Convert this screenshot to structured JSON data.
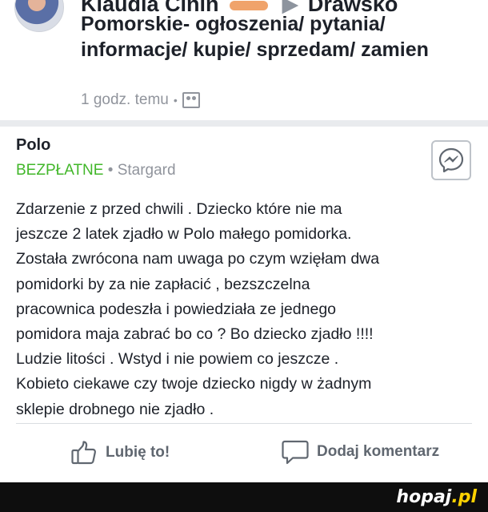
{
  "post_header": {
    "author_visible": "Klaudia  Cinin",
    "group_partial": "Drawsko",
    "group_name": "Pomorskie- ogłoszenia/ pytania/ informacje/ kupie/ sprzedam/ zamien",
    "time": "1 godz. temu",
    "separator": "•",
    "audience_icon": "group-icon"
  },
  "listing": {
    "title": "Polo",
    "price": "BEZPŁATNE",
    "separator": "•",
    "location": "Stargard",
    "messenger_icon": "messenger-icon"
  },
  "post": {
    "lines": [
      "Zdarzenie z przed chwili . Dziecko które nie ma",
      "jeszcze 2 latek zjadło w Polo małego pomidorka.",
      "Została zwrócona nam uwaga po czym wzięłam dwa",
      "pomidorki by za nie zapłacić , bezszczelna",
      "pracownica podeszła i powiedziała ze jednego",
      "pomidora maja zabrać bo co ? Bo dziecko zjadło !!!!",
      "Ludzie litości . Wstyd i nie powiem co jeszcze .",
      "Kobieto ciekawe czy twoje dziecko nigdy w żadnym",
      "sklepie drobnego nie zjadło ."
    ]
  },
  "actions": {
    "like_label": "Lubię to!",
    "comment_label": "Dodaj komentarz",
    "like_icon": "thumbs-up-icon",
    "comment_icon": "comment-bubble-icon"
  },
  "watermark": {
    "name": "hopaj",
    "tld": ".pl"
  },
  "colors": {
    "price_green": "#42b72a",
    "meta_gray": "#90949c",
    "action_gray": "#606770",
    "text": "#1d2129"
  }
}
